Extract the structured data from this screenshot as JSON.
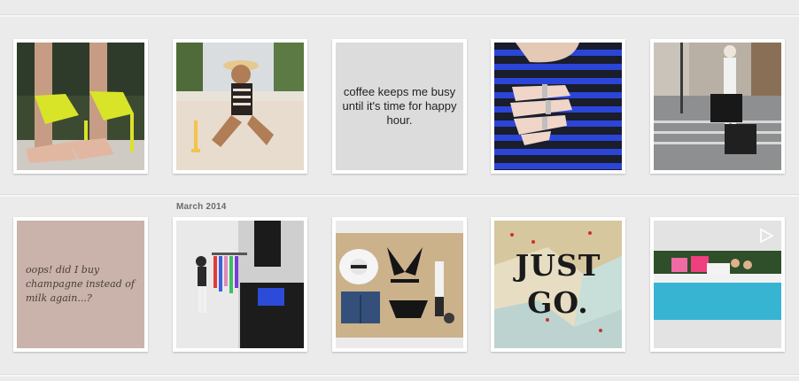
{
  "feed": {
    "month_label": "March 2014",
    "posts_row1": [
      {
        "kind": "photo",
        "subject": "yellow strappy heels"
      },
      {
        "kind": "photo",
        "subject": "woman in swimsuit with champagne"
      },
      {
        "kind": "quote",
        "text": "coffee keeps me busy until it's time for happy hour."
      },
      {
        "kind": "photo",
        "subject": "hand with rings on striped top"
      },
      {
        "kind": "photo",
        "subject": "woman with bebe shopping bags"
      }
    ],
    "posts_row2": [
      {
        "kind": "quote",
        "text": "oops! did I buy champagne instead of milk again...?"
      },
      {
        "kind": "photo",
        "subject": "photo shoot behind the scenes"
      },
      {
        "kind": "photo",
        "subject": "flat lay bikini, hat and shorts"
      },
      {
        "kind": "photo",
        "subject": "map with text",
        "overlay_lines": [
          "JUST",
          "GO."
        ]
      },
      {
        "kind": "video",
        "subject": "friends by the pool",
        "icon": "play-icon"
      }
    ]
  }
}
